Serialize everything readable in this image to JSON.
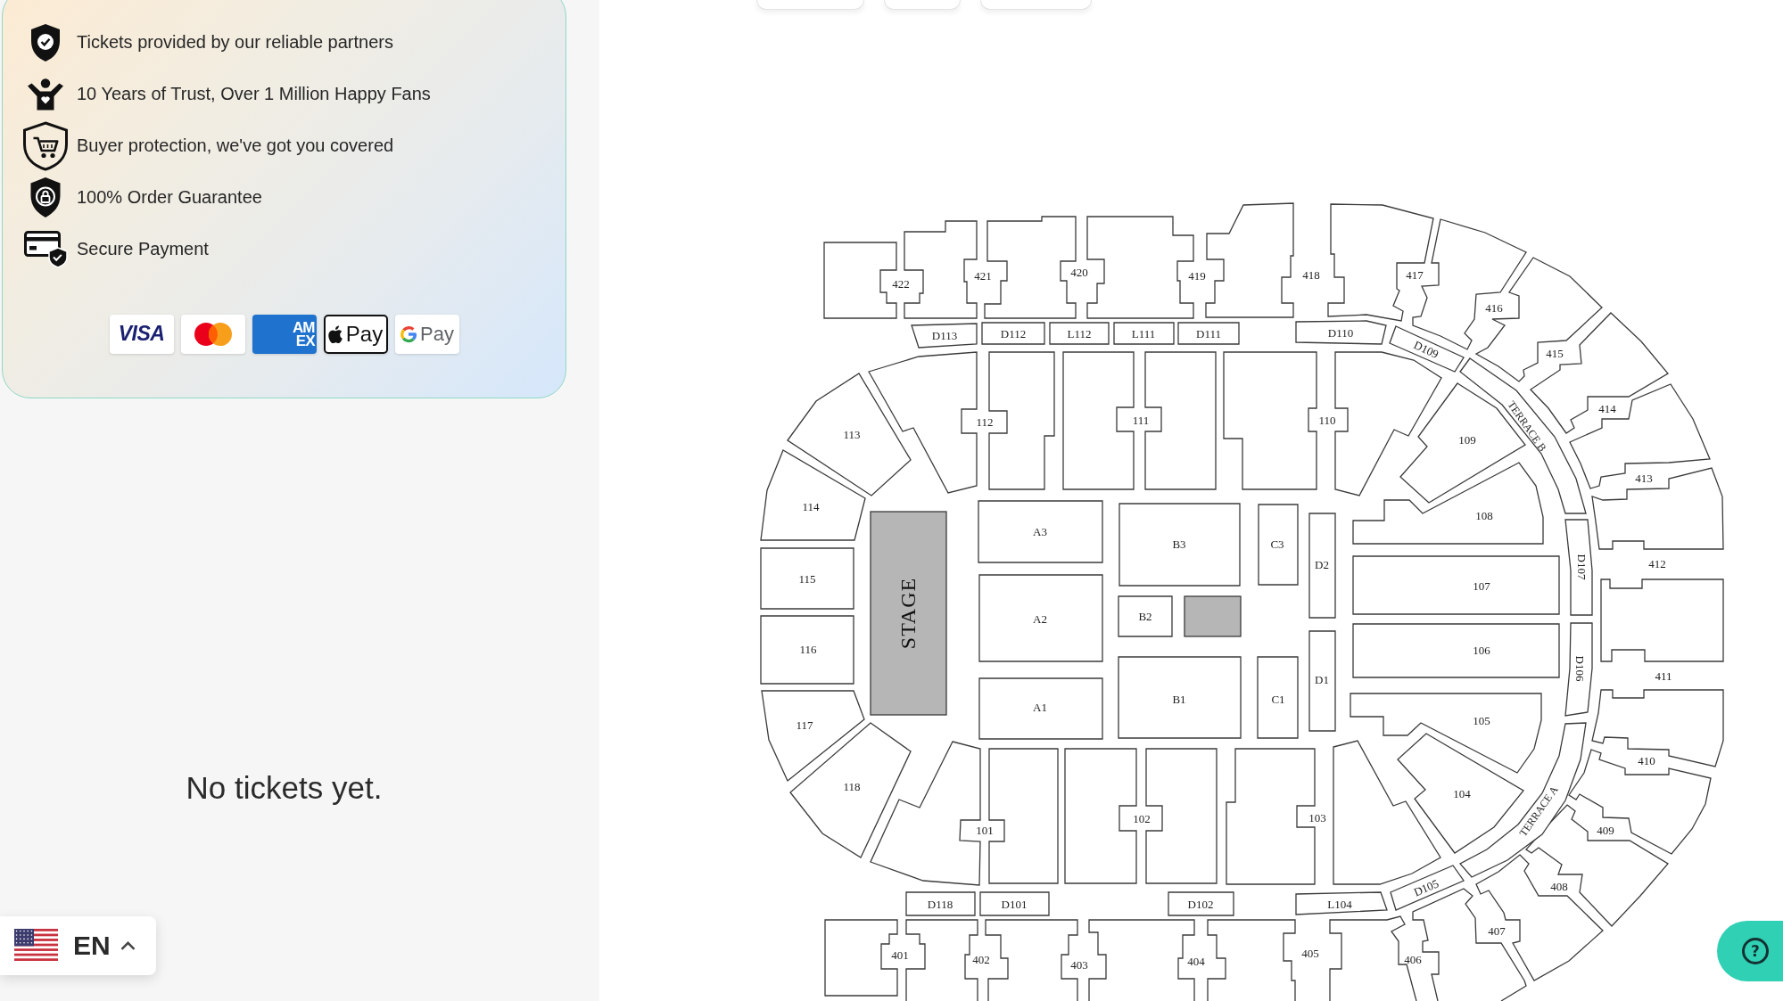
{
  "trust_panel": {
    "features": [
      {
        "kind": "shield-check",
        "text": "Tickets provided by our reliable partners"
      },
      {
        "kind": "fan",
        "text": "10 Years of Trust, Over 1 Million Happy Fans"
      },
      {
        "kind": "shield-cart",
        "text": "Buyer protection, we've got you covered"
      },
      {
        "kind": "shield-lock",
        "text": "100% Order Guarantee"
      },
      {
        "kind": "card-shield",
        "text": "Secure Payment"
      }
    ],
    "payment_methods": [
      {
        "kind": "visa",
        "text": "VISA"
      },
      {
        "kind": "mastercard"
      },
      {
        "kind": "amex",
        "lines": [
          "AM",
          "EX"
        ]
      },
      {
        "kind": "apple-pay",
        "text": "Pay"
      },
      {
        "kind": "google-pay",
        "text": "Pay"
      }
    ]
  },
  "tickets": {
    "empty_message": "No tickets yet."
  },
  "seat_map": {
    "stage": "STAGE",
    "sections": [
      "422",
      "421",
      "420",
      "419",
      "418",
      "417",
      "416",
      "D113",
      "D112",
      "L112",
      "L111",
      "D111",
      "D110",
      "D109",
      "415",
      "113",
      "112",
      "111",
      "110",
      "109",
      "TERRACE B",
      "414",
      "114",
      "108",
      "413",
      "115",
      "A3",
      "B3",
      "C3",
      "D2",
      "107",
      "D107",
      "412",
      "116",
      "A2",
      "B2",
      "D1",
      "106",
      "D106",
      "411",
      "117",
      "A1",
      "B1",
      "C1",
      "105",
      "410",
      "118",
      "101",
      "102",
      "103",
      "104",
      "TERRACE A",
      "409",
      "D118",
      "D101",
      "D102",
      "L104",
      "D105",
      "408",
      "401",
      "402",
      "403",
      "404",
      "405",
      "406",
      "407"
    ]
  },
  "language_selector": {
    "code": "EN"
  },
  "help_button": {
    "symbol": "?"
  }
}
